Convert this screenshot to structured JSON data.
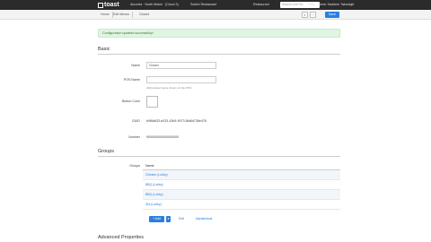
{
  "topbar": {
    "logo": "toast",
    "location": "Alucerta · North Miami · (Cloud 3)",
    "restaurant_select": "Switch Restaurant",
    "restaurant_menu": "Restaurant",
    "help": "Help",
    "user": "Amer Haddem Takedajel",
    "search_placeholder": "Search (Ctrl+K)"
  },
  "subbar": {
    "crumbs": [
      "Home",
      "Edit Menus",
      "Closed"
    ],
    "save_label": "Save"
  },
  "alert": {
    "text": "Configuration updated successfully!"
  },
  "basic": {
    "title": "Basic",
    "name_label": "Name",
    "name_value": "Closed",
    "pos_label": "POS Name",
    "pos_value": "",
    "pos_hint": "Abbreviated name shown on the POS",
    "button_color_label": "Button Color",
    "guid_label": "GUID",
    "guid_value": "b9f8a633-e033-43b5-9073-f8d6d738e478",
    "number_label": "Number",
    "number_value": "900000000000000000"
  },
  "groups": {
    "title": "Groups",
    "label": "Groups",
    "column_header": "Name",
    "rows": [
      "Chicken (Lobby)",
      "BBQ (Lobby)",
      "BBQ (Lobby)",
      "ISA (Lobby)"
    ],
    "add_label": "+ Add",
    "edit_label": "Edit",
    "alpha_label": "Alphabetical"
  },
  "advanced": {
    "title": "Advanced Properties"
  }
}
